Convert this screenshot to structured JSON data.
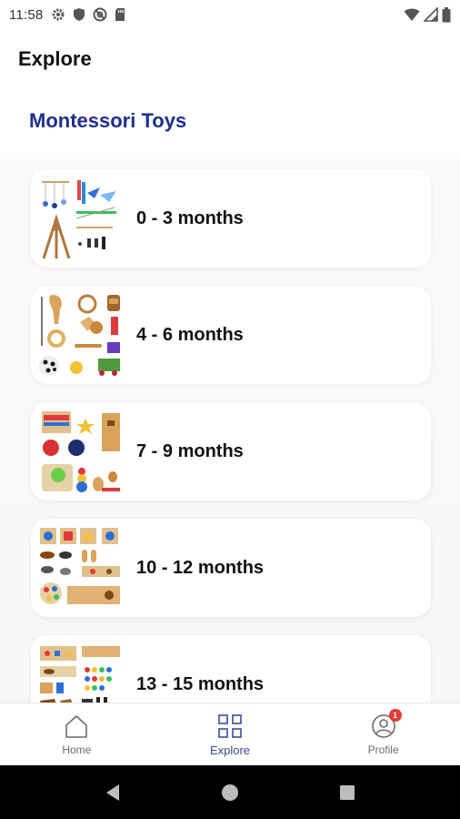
{
  "status_bar": {
    "time": "11:58",
    "icons": [
      "gear-icon",
      "shield-icon",
      "at-sign-icon",
      "sd-card-icon"
    ],
    "right_icons": [
      "wifi-icon",
      "signal-icon",
      "battery-icon"
    ]
  },
  "header": {
    "title": "Explore"
  },
  "section": {
    "title": "Montessori Toys"
  },
  "cards": [
    {
      "label": "0 - 3 months",
      "thumb": "mobiles-and-play-gym-thumbnail"
    },
    {
      "label": "4 - 6 months",
      "thumb": "grasping-toys-thumbnail"
    },
    {
      "label": "7 - 9 months",
      "thumb": "object-permanence-toys-thumbnail"
    },
    {
      "label": "10 - 12 months",
      "thumb": "puzzles-and-animals-thumbnail"
    },
    {
      "label": "13 - 15 months",
      "thumb": "shape-puzzles-thumbnail"
    }
  ],
  "bottom_nav": {
    "items": [
      {
        "label": "Home",
        "icon": "home-icon",
        "active": false
      },
      {
        "label": "Explore",
        "icon": "grid-icon",
        "active": true
      },
      {
        "label": "Profile",
        "icon": "profile-icon",
        "active": false,
        "badge": "1"
      }
    ]
  },
  "colors": {
    "section_title": "#1e2f8c",
    "active_nav": "#3b4b9c",
    "badge": "#e53935"
  }
}
